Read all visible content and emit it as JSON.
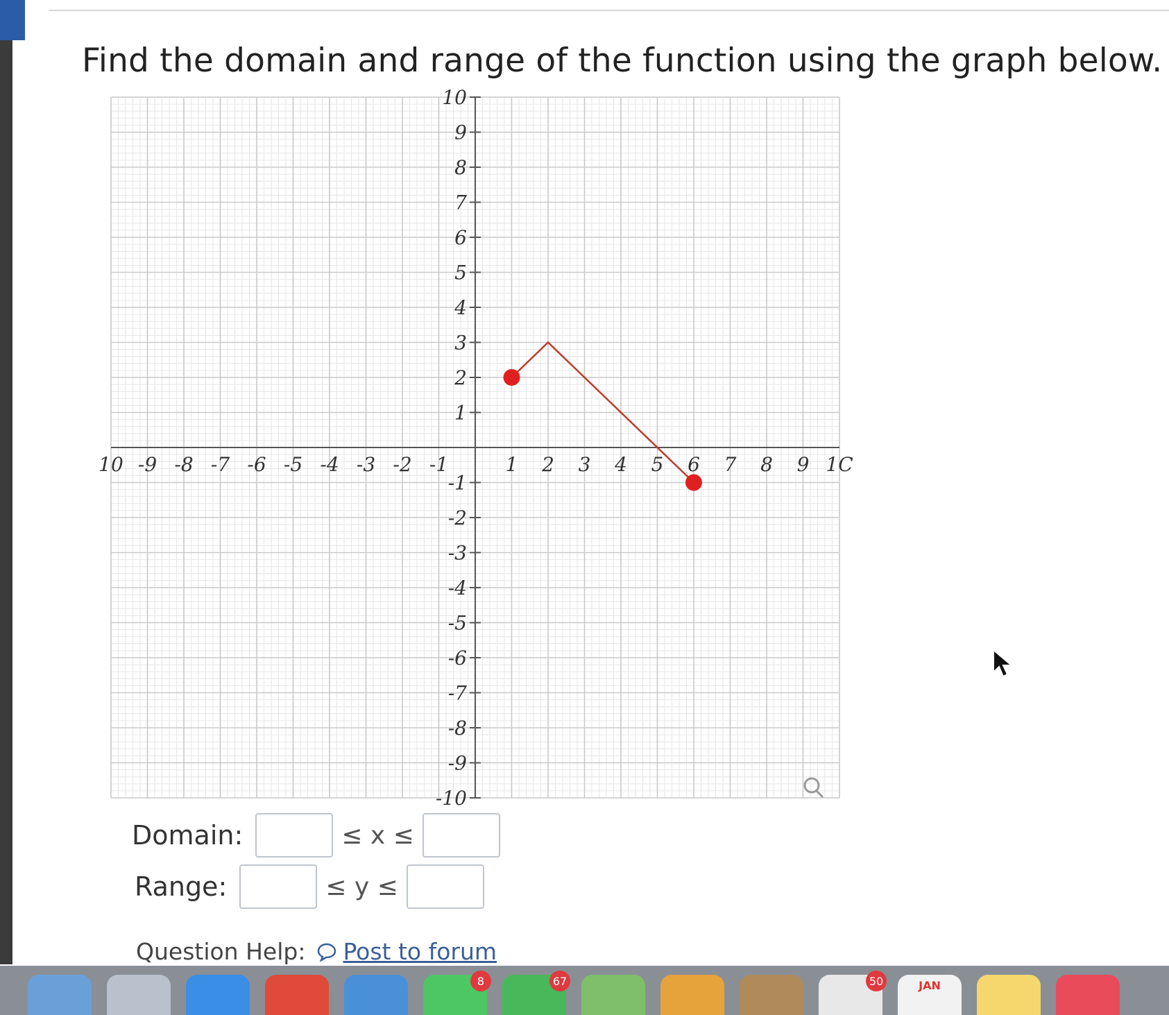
{
  "question": "Find the domain and range of the function using the graph below.",
  "graph": {
    "x_min": -10,
    "x_max": 10,
    "y_min": -10,
    "y_max": 10,
    "x_tick_labels": [
      "10",
      "-9",
      "-8",
      "-7",
      "-6",
      "-5",
      "-4",
      "-3",
      "-2",
      "-1",
      "1",
      "2",
      "3",
      "4",
      "5",
      "6",
      "7",
      "8",
      "9",
      "1C"
    ],
    "y_tick_labels": [
      "10",
      "9",
      "8",
      "7",
      "6",
      "5",
      "4",
      "3",
      "2",
      "1",
      "-1",
      "-2",
      "-3",
      "-4",
      "-5",
      "-6",
      "-7",
      "-8",
      "-9",
      "-10"
    ],
    "function_points": [
      [
        1,
        2
      ],
      [
        2,
        3
      ],
      [
        6,
        -1
      ]
    ],
    "endpoints": [
      [
        1,
        2
      ],
      [
        6,
        -1
      ]
    ],
    "line_color": "#c0392b",
    "point_color": "#e02020",
    "grid_color": "#c9c9c9",
    "zoom_icon": "magnifier-icon"
  },
  "domain": {
    "label": "Domain:",
    "operator_text": "≤ x ≤",
    "lower_value": "",
    "upper_value": ""
  },
  "range": {
    "label": "Range:",
    "operator_text": "≤ y ≤",
    "lower_value": "",
    "upper_value": ""
  },
  "help": {
    "label": "Question Help:",
    "forum_link": "Post to forum",
    "forum_icon": "speech-bubble-icon"
  },
  "dock": {
    "icons": [
      {
        "name": "launchpad-icon",
        "color": "#6aa0d8",
        "badge": ""
      },
      {
        "name": "apps-grid-icon",
        "color": "#b9c2cc",
        "badge": ""
      },
      {
        "name": "safari-icon",
        "color": "#3a8ee6",
        "badge": ""
      },
      {
        "name": "chrome-icon",
        "color": "#e04a3a",
        "badge": ""
      },
      {
        "name": "mail-icon",
        "color": "#4a90d9",
        "badge": ""
      },
      {
        "name": "messages-icon",
        "color": "#4cc764",
        "badge": "8"
      },
      {
        "name": "facetime-icon",
        "color": "#48b85a",
        "badge": "67"
      },
      {
        "name": "maps-icon",
        "color": "#7fbf6a",
        "badge": ""
      },
      {
        "name": "photos-icon",
        "color": "#e6a33c",
        "badge": ""
      },
      {
        "name": "contacts-icon",
        "color": "#b08a5a",
        "badge": ""
      },
      {
        "name": "reminders-icon",
        "color": "#e8e8e8",
        "badge": "50"
      },
      {
        "name": "calendar-icon",
        "color": "#f2f2f2",
        "badge": "",
        "label": "JAN"
      },
      {
        "name": "notes-icon",
        "color": "#f5d76e",
        "badge": ""
      },
      {
        "name": "app-icon",
        "color": "#e94b5a",
        "badge": ""
      }
    ]
  }
}
